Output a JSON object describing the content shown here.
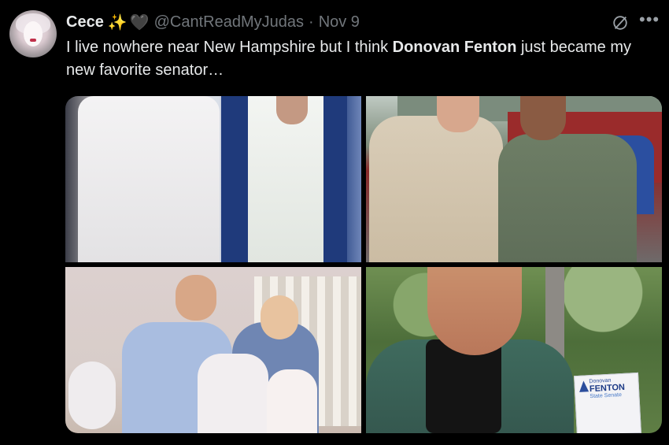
{
  "post": {
    "author_name": "Cece",
    "author_emoji_1": "✨",
    "author_emoji_2": "🖤",
    "handle": "@CantReadMyJudas",
    "separator": "·",
    "date": "Nov 9",
    "text_before": "I live nowhere near New Hampshire but I think ",
    "text_bold": "Donovan Fenton",
    "text_after": " just became my new favorite senator…",
    "more_label": "•••"
  },
  "media": {
    "sign": {
      "line1": "Donovan",
      "line2": "FENTON",
      "line3": "State Senate"
    }
  },
  "icons": {
    "grok": "grok-icon",
    "more": "more-icon"
  },
  "colors": {
    "background": "#000000",
    "text": "#e7e9ea",
    "secondary_text": "#71767b"
  }
}
